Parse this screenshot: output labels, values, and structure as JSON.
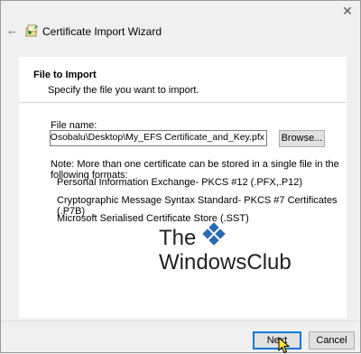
{
  "window": {
    "close_glyph": "✕",
    "back_glyph": "←",
    "title": "Certificate Import Wizard"
  },
  "section": {
    "title": "File to Import",
    "description": "Specify the file you want to import."
  },
  "file": {
    "label": "File name:",
    "value": "\\Users\\Chidum.Osobalu\\Desktop\\My_EFS Certificate_and_Key.pfx",
    "browse_label": "Browse..."
  },
  "note": "Note:  More than one certificate can be stored in a single file in the following formats:",
  "formats": [
    "Personal Information Exchange- PKCS #12 (.PFX,.P12)",
    "Cryptographic Message Syntax Standard- PKCS #7 Certificates (.P7B)",
    "Microsoft Serialised Certificate Store (.SST)"
  ],
  "watermark": {
    "line1": "The",
    "line2": "WindowsClub"
  },
  "buttons": {
    "next": "Next",
    "cancel": "Cancel"
  },
  "colors": {
    "focus_blue": "#0078d7",
    "logo_blue": "#2a6bb4"
  }
}
